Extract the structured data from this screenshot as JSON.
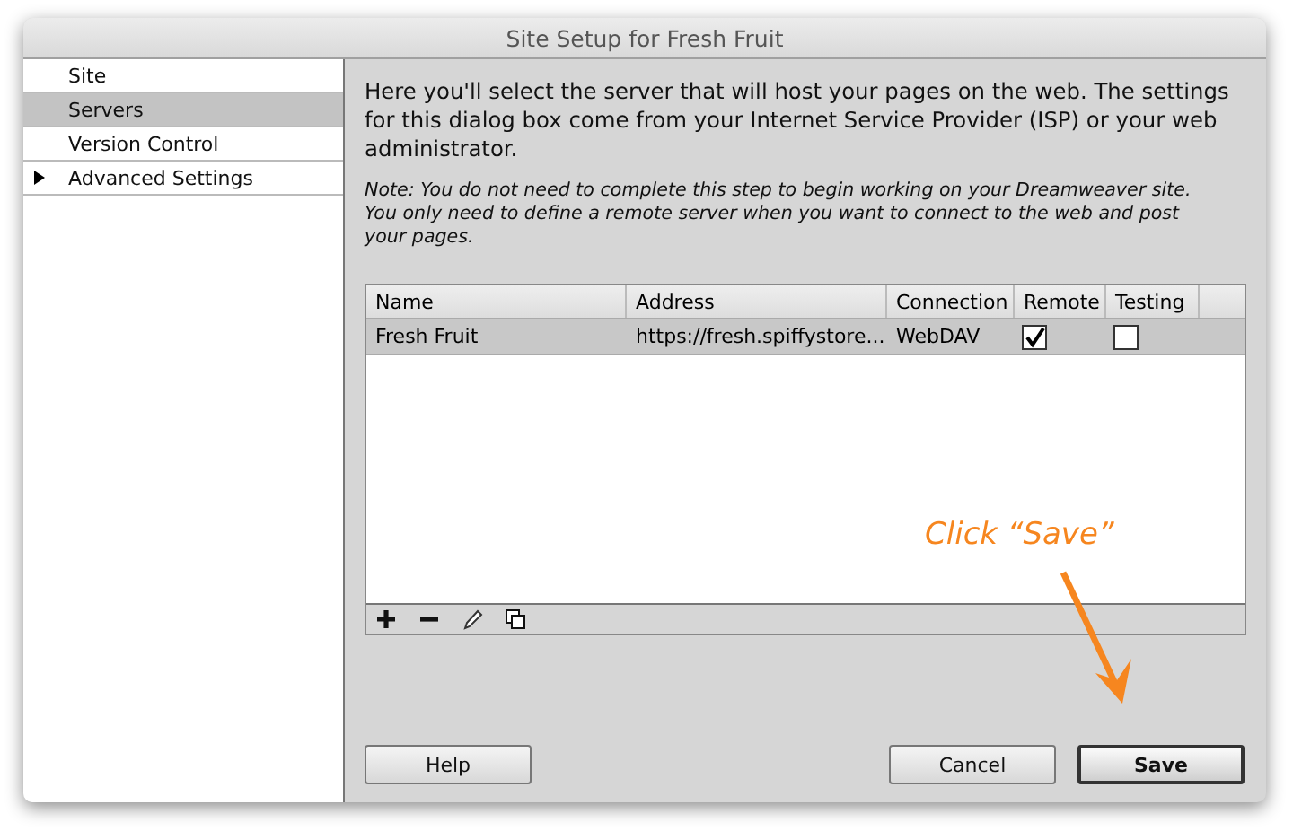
{
  "window": {
    "title": "Site Setup for Fresh Fruit"
  },
  "sidebar": {
    "items": [
      {
        "label": "Site",
        "selected": false
      },
      {
        "label": "Servers",
        "selected": true
      },
      {
        "label": "Version Control",
        "selected": false
      },
      {
        "label": "Advanced Settings",
        "selected": false,
        "expanded": false
      }
    ]
  },
  "intro": "Here you'll select the server that will host your pages on the web. The settings for this dialog box come from your Internet Service Provider (ISP) or your web administrator.",
  "note": "Note: You do not need to complete this step to begin working on your Dreamweaver site. You only need to define a remote server when you want to connect to the web and post your pages.",
  "table": {
    "columns": [
      "Name",
      "Address",
      "Connection",
      "Remote",
      "Testing"
    ],
    "rows": [
      {
        "name": "Fresh Fruit",
        "address": "https://fresh.spiffystore...",
        "connection": "WebDAV",
        "remote": true,
        "testing": false,
        "selected": true
      }
    ]
  },
  "toolbar": [
    {
      "kind": "add"
    },
    {
      "kind": "remove"
    },
    {
      "kind": "edit"
    },
    {
      "kind": "duplicate"
    }
  ],
  "buttons": [
    {
      "label": "Help",
      "kind": "help",
      "default": false
    },
    {
      "label": "Cancel",
      "kind": "cancel",
      "default": false
    },
    {
      "label": "Save",
      "kind": "save",
      "default": true
    }
  ],
  "annotation": {
    "text": "Click “Save”"
  }
}
